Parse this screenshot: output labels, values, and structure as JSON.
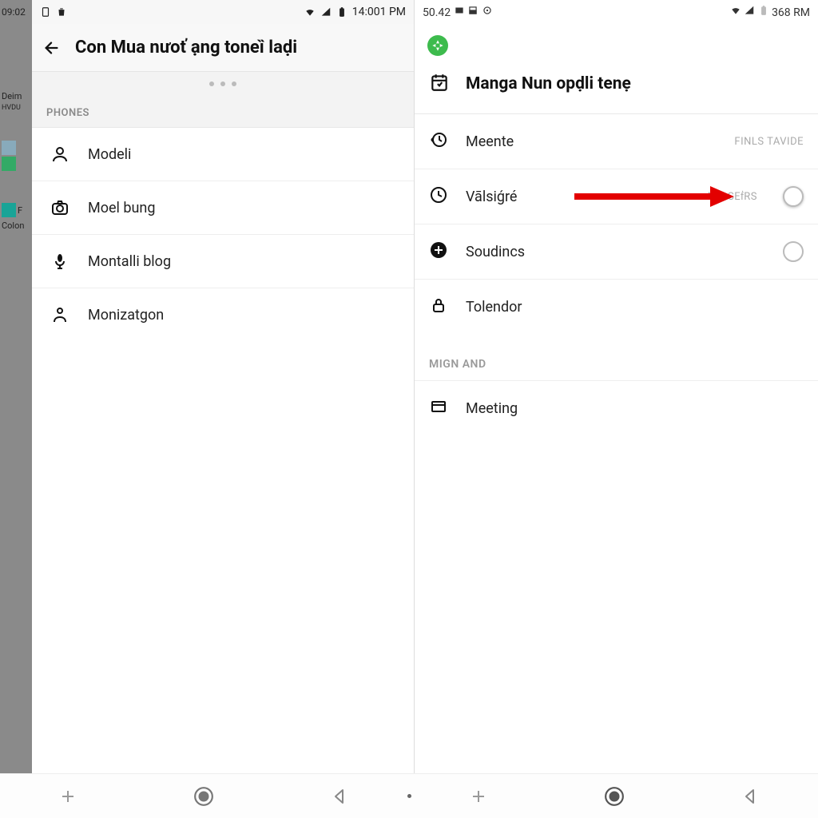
{
  "bgstrip": {
    "time": "09:02",
    "item1": "Deim",
    "item1sub": "HVDU",
    "item2": "F",
    "item3": "Colon"
  },
  "left": {
    "statusbar": {
      "time": "14:001 PM"
    },
    "title": "Con Mua nưoť ạng toneȉ laḍi",
    "section": "PHONES",
    "items": [
      {
        "icon": "person",
        "label": "Modeli"
      },
      {
        "icon": "camera",
        "label": "Moel bung"
      },
      {
        "icon": "mic",
        "label": "Montalli blog"
      },
      {
        "icon": "person-outline",
        "label": "Monizatgon"
      }
    ]
  },
  "right": {
    "statusbar": {
      "left": "50.42",
      "right": "368 RM"
    },
    "title": "Manga Nun opḍli tenẹ",
    "items": [
      {
        "icon": "history",
        "label": "Meente",
        "rtext": "FINLS TAVIDE"
      },
      {
        "icon": "clock",
        "label": "Vālsiǵré",
        "rtext": "NI3 SEḟRS",
        "radio": true
      },
      {
        "icon": "plus-circle",
        "label": "Soudincs",
        "radio": true
      },
      {
        "icon": "lock",
        "label": "Tolendor"
      }
    ],
    "section2": "MIGN AND",
    "items2": [
      {
        "icon": "card",
        "label": "Meeting"
      }
    ]
  }
}
